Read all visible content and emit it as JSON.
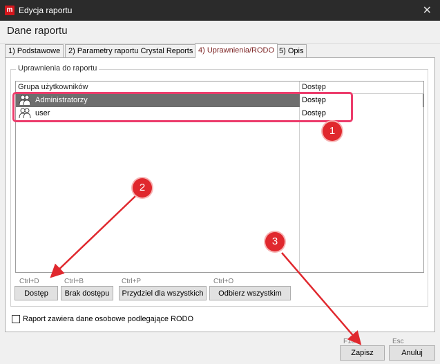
{
  "window": {
    "title": "Edycja raportu",
    "app_icon": "m",
    "close": "✕"
  },
  "header": {
    "title": "Dane raportu"
  },
  "tabs": [
    {
      "label": "1) Podstawowe",
      "active": false
    },
    {
      "label": "2) Parametry raportu Crystal Reports",
      "active": false
    },
    {
      "label": "4) Uprawnienia/RODO",
      "active": true
    },
    {
      "label": "5) Opis",
      "active": false
    }
  ],
  "permissions": {
    "group_label": "Uprawnienia do raportu",
    "columns": [
      "Grupa użytkowników",
      "Dostęp"
    ],
    "rows": [
      {
        "group": "Administratorzy",
        "access": "Dostęp",
        "icon": "user-group-icon",
        "selected": true
      },
      {
        "group": "user",
        "access": "Dostęp",
        "icon": "user-group-icon",
        "selected": false
      }
    ]
  },
  "actions": [
    {
      "shortcut": "Ctrl+D",
      "label": "Dostęp"
    },
    {
      "shortcut": "Ctrl+B",
      "label": "Brak dostępu"
    },
    {
      "shortcut": "Ctrl+P",
      "label": "Przydziel dla wszystkich"
    },
    {
      "shortcut": "Ctrl+O",
      "label": "Odbierz wszystkim"
    }
  ],
  "rodo": {
    "label": "Raport zawiera dane osobowe podlegające RODO",
    "checked": false
  },
  "footer": {
    "save": {
      "shortcut": "F10",
      "label": "Zapisz"
    },
    "cancel": {
      "shortcut": "Esc",
      "label": "Anuluj"
    }
  },
  "annotations": [
    "1",
    "2",
    "3"
  ],
  "colors": {
    "annotation": "#e0282e",
    "highlight": "#ec3c6b",
    "active_tab": "#7a1f1f",
    "selected_row": "#6e6e6e"
  }
}
